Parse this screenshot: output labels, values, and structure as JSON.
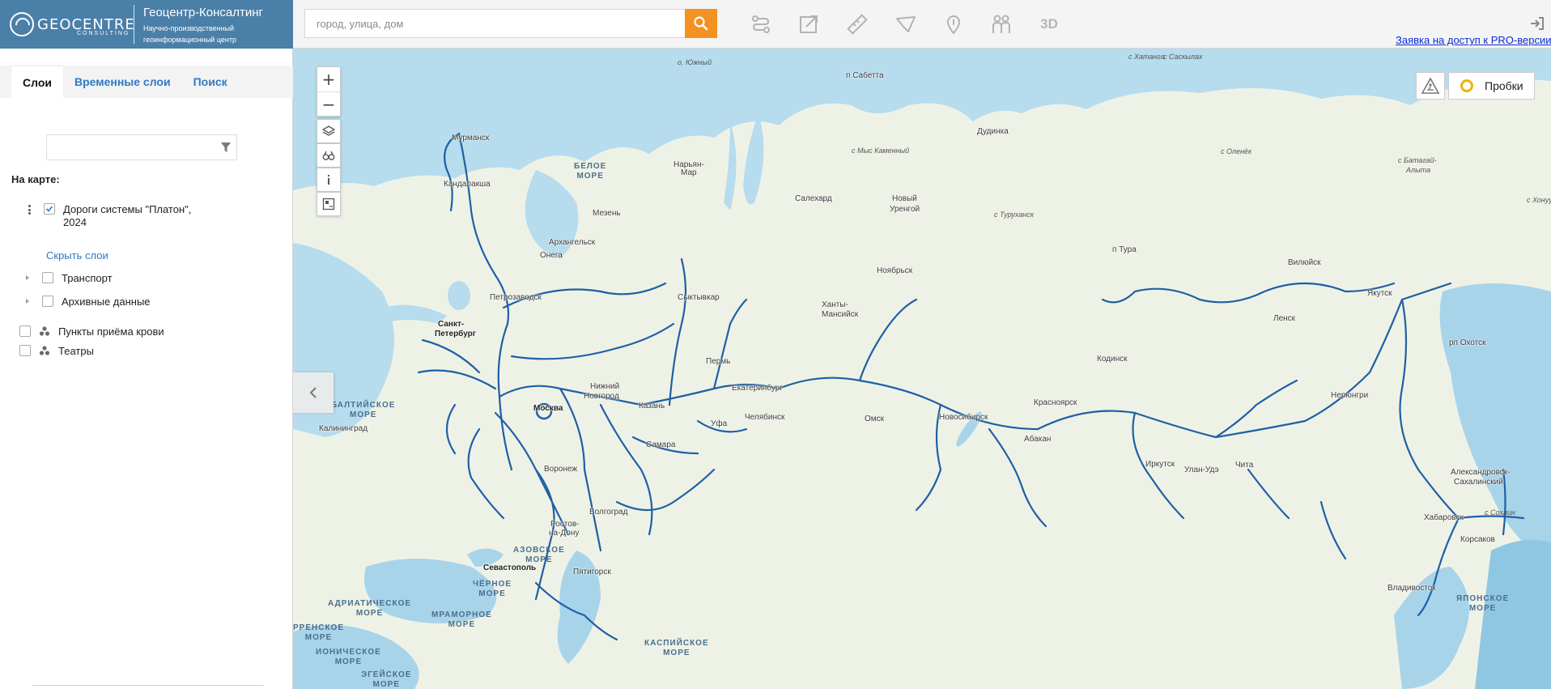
{
  "header": {
    "brand": "GEOCENTRE",
    "brand_sub": "CONSULTING",
    "title": "Геоцентр-Консалтинг",
    "desc_line1": "Научно-производственный",
    "desc_line2": "геоинформационный центр"
  },
  "search": {
    "placeholder": "город, улица, дом",
    "value": ""
  },
  "toolbar": {
    "tools": [
      "route-icon",
      "edit-icon",
      "ruler-icon",
      "area-icon",
      "poi-icon",
      "people-icon"
    ],
    "label_3d": "3D",
    "pro_link": "Заявка на доступ к PRO-версии"
  },
  "sidebar": {
    "tabs": [
      {
        "label": "Слои",
        "active": true
      },
      {
        "label": "Временные слои",
        "active": false
      },
      {
        "label": "Поиск",
        "active": false
      }
    ],
    "filter_value": "",
    "on_map_label": "На карте:",
    "platon_layer": {
      "name": "Дороги системы \"Платон\",",
      "year": "2024",
      "checked": true
    },
    "hide_layers": "Скрыть слои",
    "groups": [
      {
        "label": "Транспорт",
        "checked": false
      },
      {
        "label": "Архивные данные",
        "checked": false
      }
    ],
    "points": [
      {
        "label": "Пункты приёма крови",
        "checked": false
      },
      {
        "label": "Театры",
        "checked": false
      }
    ]
  },
  "map": {
    "traffic_label": "Пробки",
    "cities": [
      {
        "name": "Мурманск",
        "bold": false
      },
      {
        "name": "Кандалакша",
        "bold": false
      },
      {
        "name": "Мезень",
        "bold": false
      },
      {
        "name": "Архангельск",
        "bold": false
      },
      {
        "name": "Онега",
        "bold": false
      },
      {
        "name": "Нарьян-",
        "bold": false
      },
      {
        "name": "Мар",
        "bold": false
      },
      {
        "name": "Петрозаводск",
        "bold": false
      },
      {
        "name": "Сыктывкар",
        "bold": false
      },
      {
        "name": "Санкт-",
        "bold": true
      },
      {
        "name": "Петербург",
        "bold": true
      },
      {
        "name": "Пермь",
        "bold": false
      },
      {
        "name": "Нижний",
        "bold": false
      },
      {
        "name": "Новгород",
        "bold": false
      },
      {
        "name": "Екатеринбург",
        "bold": false
      },
      {
        "name": "Москва",
        "bold": true
      },
      {
        "name": "Казань",
        "bold": false
      },
      {
        "name": "Уфа",
        "bold": false
      },
      {
        "name": "Челябинск",
        "bold": false
      },
      {
        "name": "Калининград",
        "bold": false
      },
      {
        "name": "Самара",
        "bold": false
      },
      {
        "name": "Воронеж",
        "bold": false
      },
      {
        "name": "Волгоград",
        "bold": false
      },
      {
        "name": "Ростов-",
        "bold": false
      },
      {
        "name": "на-Дону",
        "bold": false
      },
      {
        "name": "Севастополь",
        "bold": true
      },
      {
        "name": "Пятигорск",
        "bold": false
      },
      {
        "name": "Салехард",
        "bold": false
      },
      {
        "name": "Новый",
        "bold": false
      },
      {
        "name": "Уренгой",
        "bold": false
      },
      {
        "name": "Ноябрьск",
        "bold": false
      },
      {
        "name": "Ханты-",
        "bold": false
      },
      {
        "name": "Мансийск",
        "bold": false
      },
      {
        "name": "Омск",
        "bold": false
      },
      {
        "name": "Новосибирск",
        "bold": false
      },
      {
        "name": "Красноярск",
        "bold": false
      },
      {
        "name": "Абакан",
        "bold": false
      },
      {
        "name": "Иркутск",
        "bold": false
      },
      {
        "name": "Улан-Удэ",
        "bold": false
      },
      {
        "name": "Чита",
        "bold": false
      },
      {
        "name": "Дудинка",
        "bold": false
      },
      {
        "name": "п Сабетта",
        "bold": false
      },
      {
        "name": "п Тура",
        "bold": false
      },
      {
        "name": "Кодинск",
        "bold": false
      },
      {
        "name": "Вилюйск",
        "bold": false
      },
      {
        "name": "Якутск",
        "bold": false
      },
      {
        "name": "Ленск",
        "bold": false
      },
      {
        "name": "Нерюнгри",
        "bold": false
      },
      {
        "name": "рп Охотск",
        "bold": false
      },
      {
        "name": "Хабаровск",
        "bold": false
      },
      {
        "name": "Владивосток",
        "bold": false
      },
      {
        "name": "Александровск-",
        "bold": false
      },
      {
        "name": "Сахалинский",
        "bold": false
      },
      {
        "name": "Корсаков",
        "bold": false
      }
    ],
    "places": [
      "о. Южный",
      "с Хатанга",
      "с Саскылах",
      "с Мыс Каменный",
      "с Оленёк",
      "с Батагай-",
      "Алыта",
      "с Туруханск",
      "с Хонуу",
      "с Сохлин"
    ],
    "seas": [
      {
        "line1": "БЕЛОЕ",
        "line2": "МОРЕ"
      },
      {
        "line1": "БАЛТИЙСКОЕ",
        "line2": "МОРЕ"
      },
      {
        "line1": "АЗОВСКОЕ",
        "line2": "МОРЕ"
      },
      {
        "line1": "ЧЁРНОЕ",
        "line2": "МОРЕ"
      },
      {
        "line1": "АДРИАТИЧЕСКОЕ",
        "line2": "МОРЕ"
      },
      {
        "line1": "МРАМОРНОЕ",
        "line2": "МОРЕ"
      },
      {
        "line1": "КАСПИЙСКОЕ",
        "line2": "МОРЕ"
      },
      {
        "line1": "ЯПОНСКОЕ",
        "line2": "МОРЕ"
      },
      {
        "line1": "ИОНИЧЕСКОЕ",
        "line2": "МОРЕ"
      },
      {
        "line1": "ЭГЕЙСКОЕ",
        "line2": "МОРЕ"
      },
      {
        "line1": "РРЕНСКОЕ",
        "line2": "МОРЕ"
      }
    ],
    "colors": {
      "road": "#1f5fa6",
      "water": "#a8d4ea",
      "land": "#eef2e6",
      "search_button": "#f39121",
      "link": "#0b2ed6"
    }
  }
}
